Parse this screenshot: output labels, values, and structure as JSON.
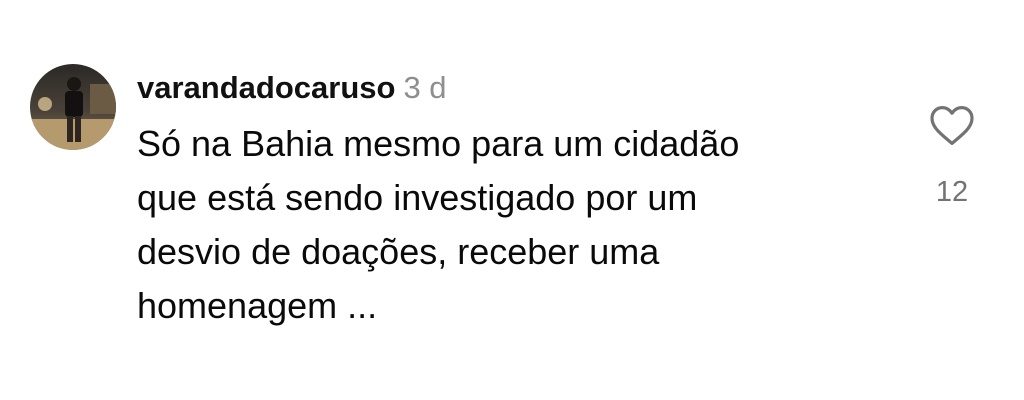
{
  "comment": {
    "username": "varandadocaruso",
    "timestamp": "3 d",
    "text_lines": [
      "Só na Bahia mesmo para um cidadão",
      "que está sendo investigado por um",
      "desvio de doações, receber uma",
      "homenagem ..."
    ],
    "like_count": "12",
    "avatar_icon": "user-photo-avatar",
    "like_icon": "heart-outline-icon"
  }
}
